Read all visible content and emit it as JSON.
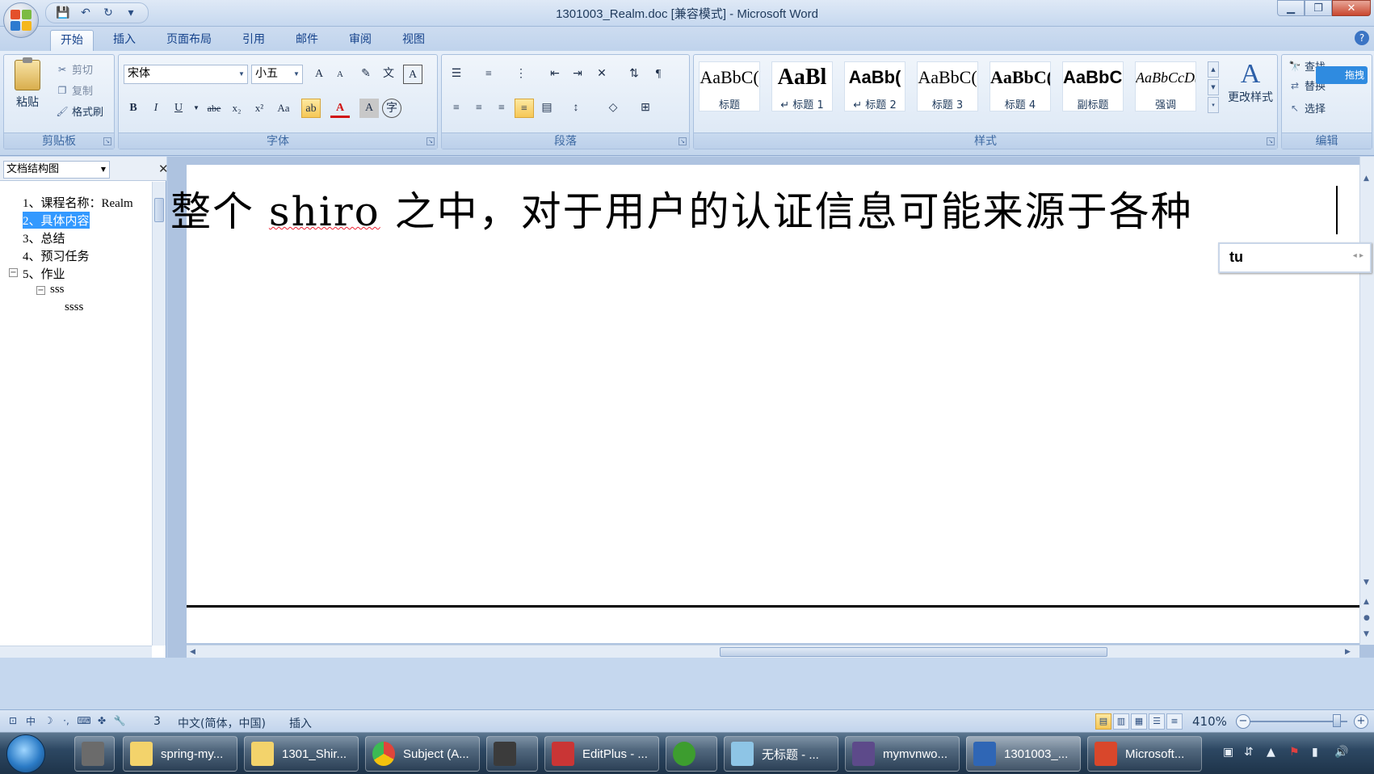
{
  "window": {
    "title": "1301003_Realm.doc [兼容模式] - Microsoft Word"
  },
  "tabs": [
    {
      "label": "开始",
      "active": true
    },
    {
      "label": "插入"
    },
    {
      "label": "页面布局"
    },
    {
      "label": "引用"
    },
    {
      "label": "邮件"
    },
    {
      "label": "审阅"
    },
    {
      "label": "视图"
    }
  ],
  "clipboard": {
    "paste": "粘贴",
    "cut": "剪切",
    "copy": "复制",
    "format_painter": "格式刷",
    "group": "剪贴板"
  },
  "font": {
    "name": "宋体",
    "size": "小五",
    "group": "字体",
    "bold": "B",
    "italic": "I",
    "underline": "U",
    "strike": "abe",
    "subscript": "x₂",
    "superscript": "x²",
    "case": "Aa",
    "grow": "A",
    "shrink": "A",
    "phonetic": "A"
  },
  "paragraph": {
    "group": "段落"
  },
  "styles": {
    "group": "样式",
    "items": [
      {
        "sample": "AaBbC(",
        "name": "标题"
      },
      {
        "sample": "AaBl",
        "name": "↵ 标题 1"
      },
      {
        "sample": "AaBb(",
        "name": "↵ 标题 2"
      },
      {
        "sample": "AaBbC(",
        "name": "标题 3"
      },
      {
        "sample": "AaBbC(",
        "name": "标题 4"
      },
      {
        "sample": "AaBbC(",
        "name": "副标题"
      },
      {
        "sample": "AaBbCcD(",
        "name": "强调"
      }
    ],
    "change": "更改样式"
  },
  "editing": {
    "find": "查找",
    "replace": "替换",
    "select": "选择",
    "group": "编辑",
    "badge": "拖拽"
  },
  "navpane": {
    "title": "文档结构图",
    "items": [
      {
        "label": "1、课程名称：Realm"
      },
      {
        "label": "2、具体内容"
      },
      {
        "label": "3、总结"
      },
      {
        "label": "4、预习任务"
      },
      {
        "label": "5、作业"
      },
      {
        "label": "sss"
      },
      {
        "label": "ssss"
      }
    ]
  },
  "document": {
    "text_before": "整个 ",
    "text_spell": "shiro",
    "text_after": " 之中，对于用户的认证信息可能来源于各种"
  },
  "ime": {
    "composition": "tu"
  },
  "status": {
    "language": "中文(简体，中国)",
    "mode": "插入",
    "zoom": "410%"
  },
  "taskbar": {
    "items": [
      {
        "label": "spring-my...",
        "icon_color": "#f3d36b"
      },
      {
        "label": "1301_Shir...",
        "icon_color": "#f3d36b"
      },
      {
        "label": "Subject (A...",
        "icon_color": "#e0453b"
      },
      {
        "label": "",
        "icon_color": "#3b3b3b"
      },
      {
        "label": "EditPlus - ...",
        "icon_color": "#c93535"
      },
      {
        "label": "",
        "icon_color": "#3d9d2f"
      },
      {
        "label": "无标题 - ...",
        "icon_color": "#8ec5e6"
      },
      {
        "label": "mymvnwo...",
        "icon_color": "#5d4a8a"
      },
      {
        "label": "1301003_...",
        "icon_color": "#2f66b5"
      },
      {
        "label": "Microsoft...",
        "icon_color": "#d9472b"
      }
    ]
  },
  "colors": {
    "selection": "#3399ff",
    "ribbon": "#dbe7f5",
    "spell_error": "#e23"
  }
}
